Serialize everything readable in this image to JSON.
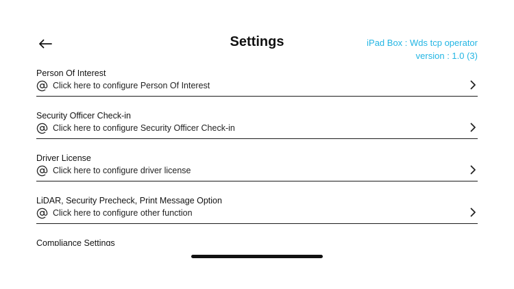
{
  "header": {
    "back_icon": "arrow-left-icon",
    "title": "Settings",
    "device_name": "iPad Box : Wds tcp operator",
    "version": "version : 1.0 (3)",
    "accent_color": "#22b5e3"
  },
  "settings": {
    "items": [
      {
        "title": "Person Of Interest",
        "description": "Click here to configure Person Of Interest",
        "icon": "at-icon"
      },
      {
        "title": "Security Officer Check-in",
        "description": "Click here to configure Security Officer Check-in",
        "icon": "at-icon"
      },
      {
        "title": "Driver License",
        "description": "Click here to configure driver license",
        "icon": "at-icon"
      },
      {
        "title": "LiDAR, Security Precheck, Print Message Option",
        "description": "Click here to configure other function",
        "icon": "at-icon"
      },
      {
        "title": "Compliance Settings",
        "description": "",
        "icon": "at-icon"
      }
    ]
  }
}
